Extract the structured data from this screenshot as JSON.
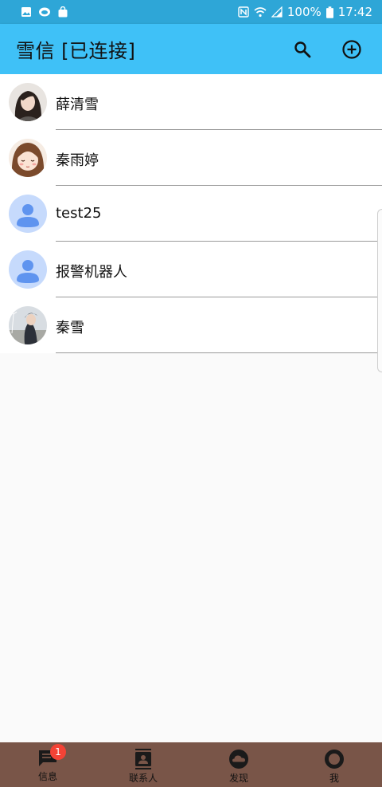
{
  "status_bar": {
    "battery": "100%",
    "time": "17:42",
    "icons": [
      "image-icon",
      "weather-icon",
      "bag-icon",
      "nfc-icon",
      "wifi-icon",
      "signal-icon",
      "battery-icon"
    ]
  },
  "app_bar": {
    "title": "雪信 [已连接]",
    "actions": [
      "search-icon",
      "add-circle-icon"
    ],
    "color": "#3fc1f7"
  },
  "contacts": [
    {
      "name": "薛清雪",
      "avatar": "photo-woman-dark-hair"
    },
    {
      "name": "秦雨婷",
      "avatar": "cartoon-girl"
    },
    {
      "name": "test25",
      "avatar": "default-person"
    },
    {
      "name": "报警机器人",
      "avatar": "default-person"
    },
    {
      "name": "秦雪",
      "avatar": "photo-man-outdoors"
    }
  ],
  "bottom_nav": {
    "color": "#795548",
    "tabs": [
      {
        "label": "信息",
        "icon": "message-icon",
        "badge": "1"
      },
      {
        "label": "联系人",
        "icon": "contacts-icon",
        "badge": ""
      },
      {
        "label": "发现",
        "icon": "cloud-icon",
        "badge": ""
      },
      {
        "label": "我",
        "icon": "profile-ring-icon",
        "badge": ""
      }
    ]
  }
}
